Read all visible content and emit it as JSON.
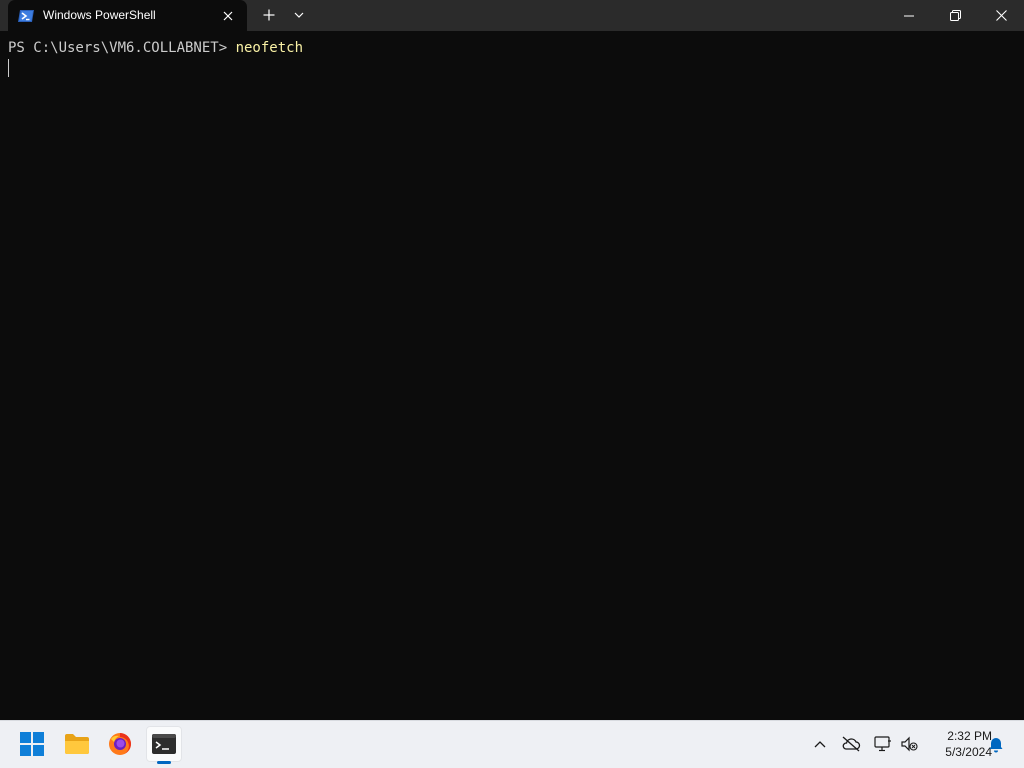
{
  "window": {
    "tab_title": "Windows PowerShell",
    "tab_icon": "powershell-icon",
    "caption_icons": [
      "minimize-icon",
      "maximize-icon",
      "close-icon"
    ]
  },
  "terminal": {
    "prompt": "PS C:\\Users\\VM6.COLLABNET> ",
    "command": "neofetch",
    "colors": {
      "background": "#0c0c0c",
      "foreground": "#cccccc",
      "command": "#f9f1a5"
    }
  },
  "taskbar": {
    "apps": [
      "windows-start-icon",
      "file-explorer-icon",
      "firefox-icon",
      "terminal-icon"
    ],
    "active_app": "terminal-icon",
    "tray_icons": [
      "chevron-up-icon",
      "onedrive-offline-icon",
      "network-icon",
      "volume-muted-icon",
      "notification-bell-icon"
    ],
    "time": "2:32 PM",
    "date": "5/3/2024",
    "accent_color": "#0067c0"
  }
}
